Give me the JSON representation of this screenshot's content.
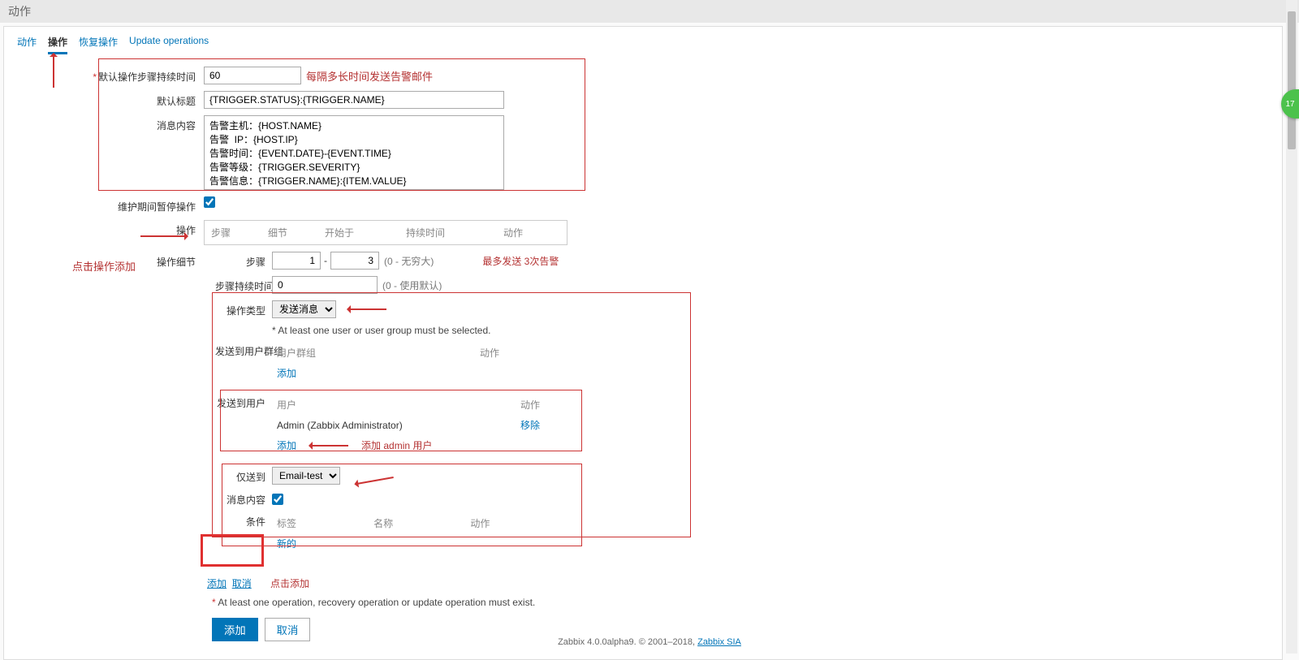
{
  "page_title": "动作",
  "tabs": {
    "t1": "动作",
    "t2": "操作",
    "t3": "恢复操作",
    "t4": "Update operations"
  },
  "labels": {
    "default_step_duration": "默认操作步骤持续时间",
    "default_subject": "默认标题",
    "message_content": "消息内容",
    "pause_in_maintenance": "维护期间暂停操作",
    "operations": "操作",
    "operation_details": "操作细节",
    "steps": "步骤",
    "step_duration": "步骤持续时间",
    "operation_type": "操作类型",
    "send_to_user_groups": "发送到用户群组",
    "send_to_users": "发送到用户",
    "send_only_to": "仅送到",
    "message_content2": "消息内容",
    "conditions": "条件"
  },
  "values": {
    "default_step_duration": "60",
    "default_subject": "{TRIGGER.STATUS}:{TRIGGER.NAME}",
    "message_content": "告警主机：{HOST.NAME}\n告警  IP：{HOST.IP}\n告警时间：{EVENT.DATE}-{EVENT.TIME}\n告警等级：{TRIGGER.SEVERITY}\n告警信息：{TRIGGER.NAME}:{ITEM.VALUE}\n事件  ID：{EVENT.ID}",
    "pause_checked": true,
    "step_from": "1",
    "step_to": "3",
    "step_duration": "0",
    "op_type_selected": "发送消息",
    "send_only_to_selected": "Email-test",
    "msg_content_checked": true,
    "user_row": "Admin (Zabbix Administrator)"
  },
  "ops_header": {
    "step": "步骤",
    "detail": "细节",
    "start": "开始于",
    "duration": "持续时间",
    "action": "动作"
  },
  "groups_table": {
    "col1": "用户群组",
    "col2": "动作",
    "add": "添加"
  },
  "users_table": {
    "col1": "用户",
    "col2": "动作",
    "remove": "移除",
    "add": "添加"
  },
  "cond_table": {
    "c1": "标签",
    "c2": "名称",
    "c3": "动作",
    "new": "新的"
  },
  "hints": {
    "step_infinite": "(0 - 无穷大)",
    "duration_default": "(0 - 使用默认)",
    "must_select": "* At least one user or user group must be selected.",
    "at_least_one_op": "At least one operation, recovery operation or update operation must exist."
  },
  "link_add": "添加",
  "link_cancel": "取消",
  "btn_add": "添加",
  "btn_cancel": "取消",
  "annotations": {
    "interval": "每隔多长时间发送告警邮件",
    "click_ops_add": "点击操作添加",
    "max_three": "最多发送 3次告警",
    "add_admin_user": "添加 admin 用户",
    "click_add": "点击添加"
  },
  "footer": {
    "text": "Zabbix 4.0.0alpha9. © 2001–2018, ",
    "link": "Zabbix SIA"
  },
  "badge": "17"
}
